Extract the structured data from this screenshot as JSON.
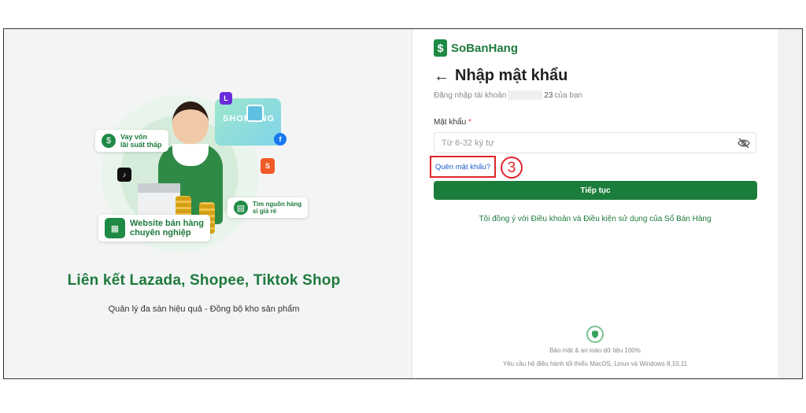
{
  "left": {
    "title": "Liên kết Lazada, Shopee, Tiktok Shop",
    "subtitle": "Quản lý đa sàn hiệu quả - Đồng bộ kho sản phẩm",
    "shopping_label": "SHOPPING",
    "badges": {
      "loan": [
        "Vay vốn",
        "lãi suất thấp"
      ],
      "source": [
        "Tìm nguồn hàng",
        "sỉ giá rẻ"
      ],
      "website": [
        "Website bán hàng",
        "chuyên nghiệp"
      ]
    }
  },
  "brand": {
    "name": "SoBanHang",
    "mark": "$",
    "color": "#1e8a44"
  },
  "form": {
    "back_glyph": "←",
    "title": "Nhập mật khẩu",
    "login_prefix": "Đăng nhập tài khoản",
    "phone_suffix": "23",
    "login_suffix": "của bạn",
    "password_label": "Mật khẩu",
    "required_mark": "*",
    "password_placeholder": "Từ 6-32 ký tự",
    "forgot_link": "Quên mật khẩu?",
    "step_marker": "3",
    "continue_button": "Tiếp tục",
    "terms": "Tôi đồng ý với Điều khoản và Điều kiện sử dụng của Sổ Bán Hàng"
  },
  "footer": {
    "security": "Bảo mật & an toàn dữ liệu 100%",
    "requirements": "Yêu cầu hệ điều hành tối thiểu MacOS, Linux và Windows 8,10,11"
  },
  "colors": {
    "primary_green": "#1b7d3c",
    "highlight_red": "#e0242a",
    "link_blue": "#1a5fc9"
  }
}
